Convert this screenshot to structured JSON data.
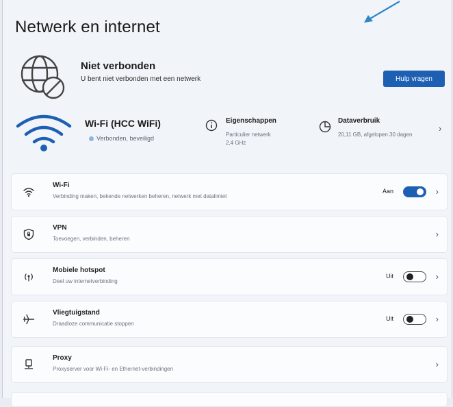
{
  "page": {
    "title": "Netwerk en internet"
  },
  "status": {
    "title": "Niet verbonden",
    "subtitle": "U bent niet verbonden met een netwerk",
    "help_label": "Hulp vragen"
  },
  "wifi_card": {
    "name": "Wi-Fi (HCC WiFi)",
    "state": "Verbonden, beveiligd",
    "properties": {
      "title": "Eigenschappen",
      "line1": "Particulier netwerk",
      "line2": "2,4 GHz"
    },
    "data_usage": {
      "title": "Dataverbruik",
      "line1": "20,11 GB, afgelopen 30 dagen"
    }
  },
  "settings": [
    {
      "label": "Wi-Fi",
      "desc": "Verbinding maken, bekende netwerken beheren, netwerk met datalimiet",
      "state": "Aan",
      "toggle": true,
      "icon": "wifi-icon"
    },
    {
      "label": "VPN",
      "desc": "Toevoegen, verbinden, beheren",
      "icon": "vpn-shield-icon"
    },
    {
      "label": "Mobiele hotspot",
      "desc": "Deel uw internetverbinding",
      "state": "Uit",
      "toggle": false,
      "icon": "hotspot-icon"
    },
    {
      "label": "Vliegtuigstand",
      "desc": "Draadloze communicatie stoppen",
      "state": "Uit",
      "toggle": false,
      "icon": "airplane-icon"
    },
    {
      "label": "Proxy",
      "desc": "Proxyserver voor Wi-Fi- en Ethernet-verbindingen",
      "icon": "proxy-icon"
    }
  ],
  "colors": {
    "accent": "#1d5fb3",
    "annotation_arrow": "#2f86c9",
    "background": "#f1f4f8"
  }
}
